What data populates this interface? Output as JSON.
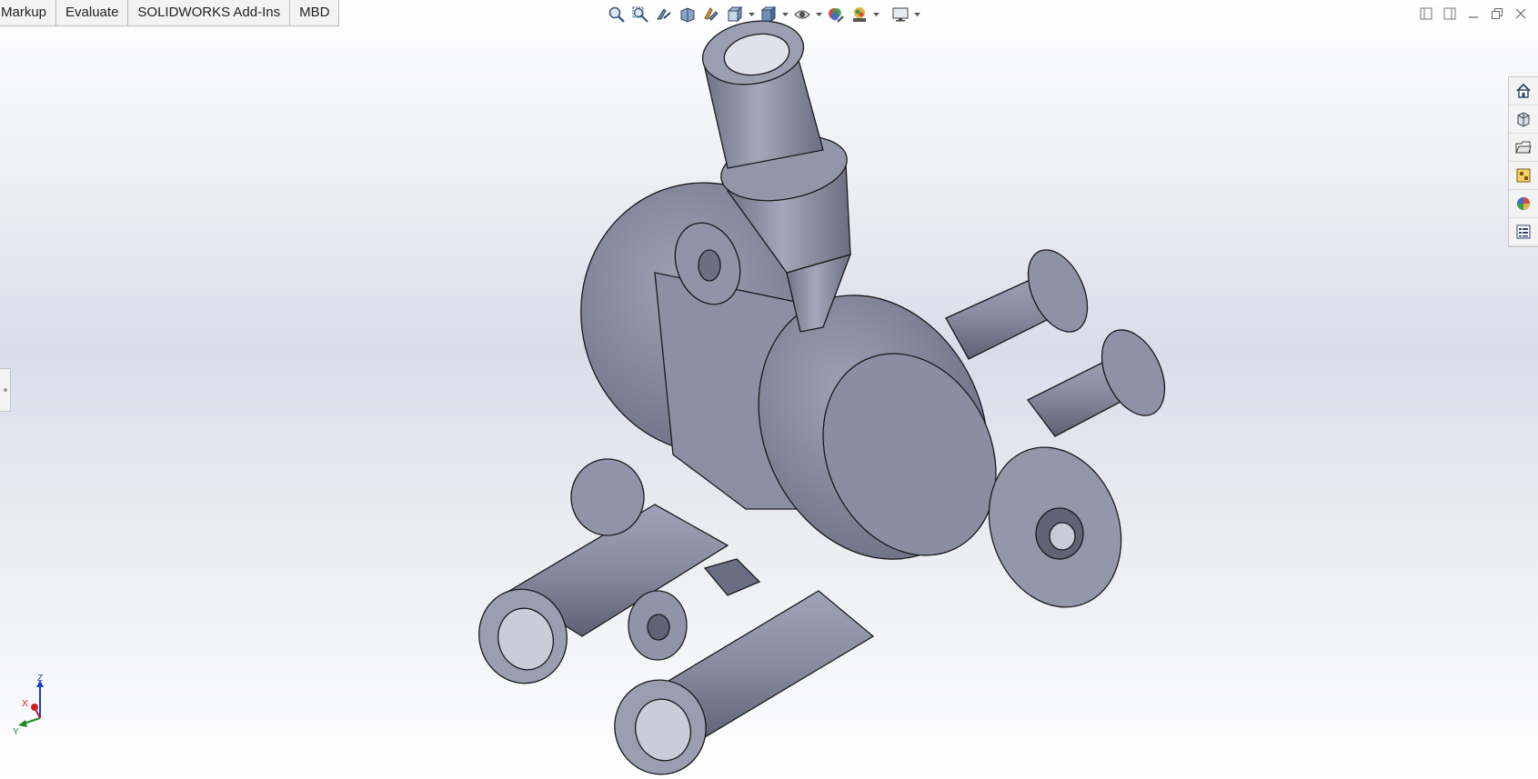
{
  "command_tabs": [
    {
      "label": "Markup"
    },
    {
      "label": "Evaluate"
    },
    {
      "label": "SOLIDWORKS Add-Ins"
    },
    {
      "label": "MBD"
    }
  ],
  "heads_up_toolbar": {
    "icons": [
      "zoom-to-fit-icon",
      "zoom-to-area-icon",
      "previous-view-icon",
      "section-view-icon",
      "dynamic-annotation-view-icon",
      "view-orientation-icon",
      "display-style-icon",
      "hide-show-items-icon",
      "edit-appearance-icon",
      "apply-scene-icon",
      "view-settings-icon"
    ]
  },
  "task_pane": {
    "icons": [
      "home-icon",
      "design-library-icon",
      "file-explorer-icon",
      "view-palette-icon",
      "appearances-icon",
      "custom-properties-icon"
    ]
  },
  "triad": {
    "z": "Z",
    "x": "X",
    "y": "Y"
  },
  "colors": {
    "part_face": "#8a8ea3",
    "part_dark": "#5d6174",
    "part_light": "#a7abbd",
    "edge": "#1a1a1a",
    "tab_bg": "#f3f3f3"
  }
}
